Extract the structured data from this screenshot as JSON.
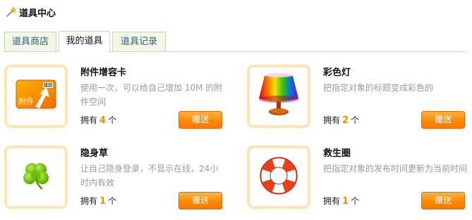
{
  "header": {
    "title": "道具中心",
    "icon": "wand-star-icon"
  },
  "tabs": [
    {
      "label": "道具商店",
      "active": false
    },
    {
      "label": "我的道具",
      "active": true
    },
    {
      "label": "道具记录",
      "active": false
    }
  ],
  "items": [
    {
      "name": "附件增容卡",
      "description": "使用一次，可以给自己增加 10M 的附件空间",
      "own_prefix": "拥有",
      "count": "4",
      "own_suffix": "个",
      "button": "赠送",
      "icon": "attachment-card-icon",
      "icon_text": "附件"
    },
    {
      "name": "彩色灯",
      "description": "把指定对象的标题变成彩色的",
      "own_prefix": "拥有",
      "count": "2",
      "own_suffix": "个",
      "button": "赠送",
      "icon": "rainbow-lamp-icon"
    },
    {
      "name": "隐身草",
      "description": "让自己隐身登录，不显示在线，24小时内有效",
      "own_prefix": "拥有",
      "count": "1",
      "own_suffix": "个",
      "button": "赠送",
      "icon": "clover-icon"
    },
    {
      "name": "救生圈",
      "description": "把指定对象的发布时间更新为当前时间",
      "own_prefix": "拥有",
      "count": "1",
      "own_suffix": "个",
      "button": "赠送",
      "icon": "life-ring-icon"
    }
  ],
  "colors": {
    "accent_orange": "#ff8a00",
    "count_orange": "#f08c00",
    "thumb_border": "#fbe5b3",
    "tab_border": "#c9d9a8",
    "tab_text": "#2a5d8c"
  }
}
